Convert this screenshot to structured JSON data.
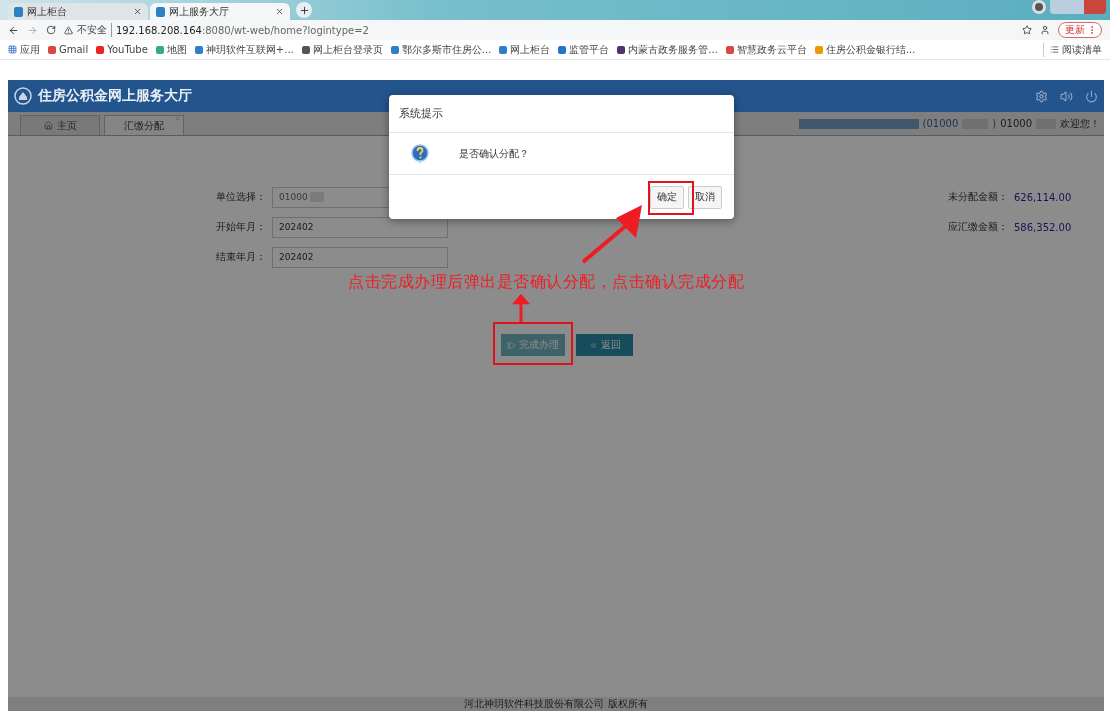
{
  "browser": {
    "tabs": [
      {
        "title": "网上柜台",
        "selected": false
      },
      {
        "title": "网上服务大厅",
        "selected": true
      }
    ],
    "address": {
      "security": "不安全",
      "url_host": "192.168.208.164",
      "url_rest": ":8080/wt-web/home?logintype=2"
    },
    "update_button": "更新",
    "bookmarks": [
      "应用",
      "Gmail",
      "YouTube",
      "地图",
      "神玥软件互联网+...",
      "网上柜台登录页",
      "鄂尔多斯市住房公...",
      "网上柜台",
      "监管平台",
      "内蒙古政务服务管...",
      "智慧政务云平台",
      "住房公积金银行结..."
    ],
    "reading_list": "阅读清单"
  },
  "app": {
    "title": "住房公积金网上服务大厅",
    "tabs": [
      {
        "label": "主页",
        "selected": false,
        "closable": false
      },
      {
        "label": "汇缴分配",
        "selected": true,
        "closable": true
      }
    ],
    "user": {
      "code_1": "(01000",
      "code_1_end": ")",
      "code_2": "01000",
      "greeting": "欢迎您！"
    },
    "fields": [
      {
        "label": "单位选择：",
        "value": "01000"
      },
      {
        "label": "开始年月：",
        "value": "202402"
      },
      {
        "label": "结束年月：",
        "value": "202402"
      }
    ],
    "totals": [
      {
        "label": "未分配金额：",
        "value": "626,114.00"
      },
      {
        "label": "应汇缴金额：",
        "value": "586,352.00"
      }
    ],
    "buttons": [
      {
        "label": "完成办理",
        "kind": "finish"
      },
      {
        "label": "返回",
        "kind": "back"
      }
    ],
    "footer": "河北神玥软件科技股份有限公司 版权所有"
  },
  "dialog": {
    "title": "系统提示",
    "message": "是否确认分配？",
    "buttons": [
      {
        "label": "确定"
      },
      {
        "label": "取消"
      }
    ]
  },
  "annotation": "点击完成办理后弹出是否确认分配，点击确认完成分配"
}
